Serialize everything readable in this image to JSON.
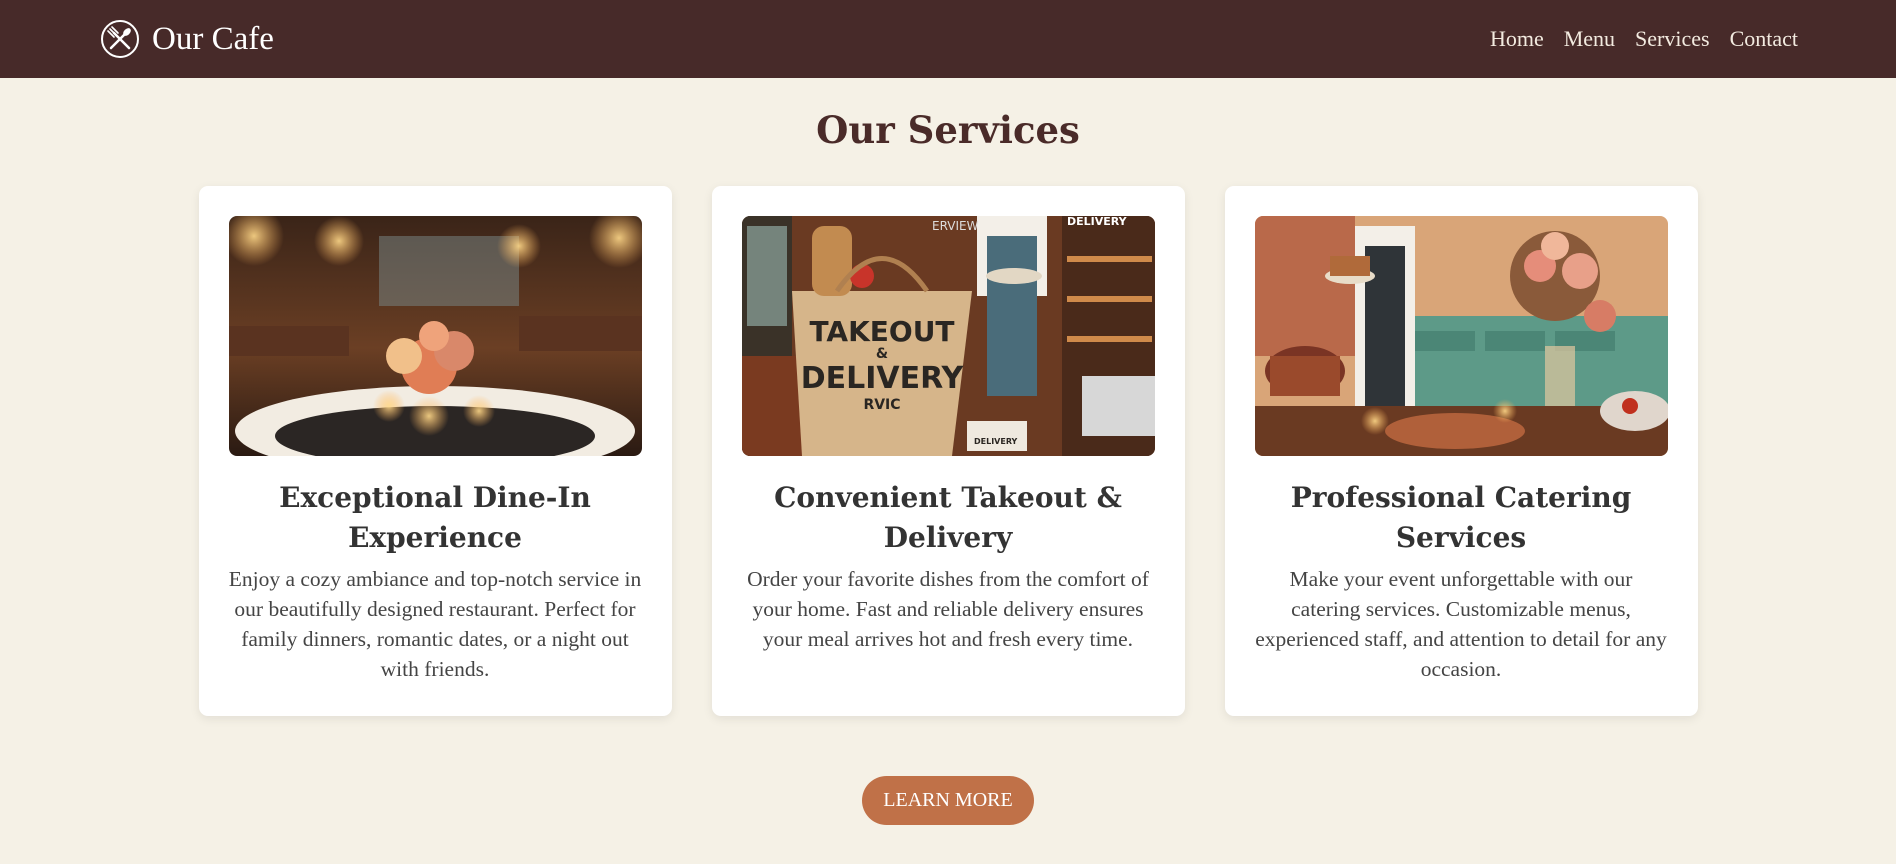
{
  "brand": {
    "name": "Our Cafe",
    "icon": "fork-knife-icon"
  },
  "nav": {
    "items": [
      "Home",
      "Menu",
      "Services",
      "Contact"
    ]
  },
  "services": {
    "title": "Our Services",
    "cards": [
      {
        "title": "Exceptional Dine-In Experience",
        "text": "Enjoy a cozy ambiance and top-notch service in our beautifully designed restaurant. Perfect for family dinners, romantic dates, or a night out with friends."
      },
      {
        "title": "Convenient Takeout & Delivery",
        "text": "Order your favorite dishes from the comfort of your home. Fast and reliable delivery ensures your meal arrives hot and fresh every time.",
        "image_text": {
          "bag_line1": "TAKEOUT",
          "bag_line2": "&",
          "bag_line3": "DELIVERY",
          "bag_line4": "RVIC",
          "sign_left": "ERVIEW",
          "sign_right": "DELIVERY",
          "box": "DELIVERY"
        }
      },
      {
        "title": "Professional Catering Services",
        "text": "Make your event unforgettable with our catering services. Customizable menus, experienced staff, and attention to detail for any occasion."
      }
    ]
  },
  "cta": {
    "label": "LEARN MORE"
  },
  "colors": {
    "nav_bg": "#472a29",
    "page_bg": "#f5f1e6",
    "accent": "#c07148",
    "heading": "#4a2b29"
  }
}
